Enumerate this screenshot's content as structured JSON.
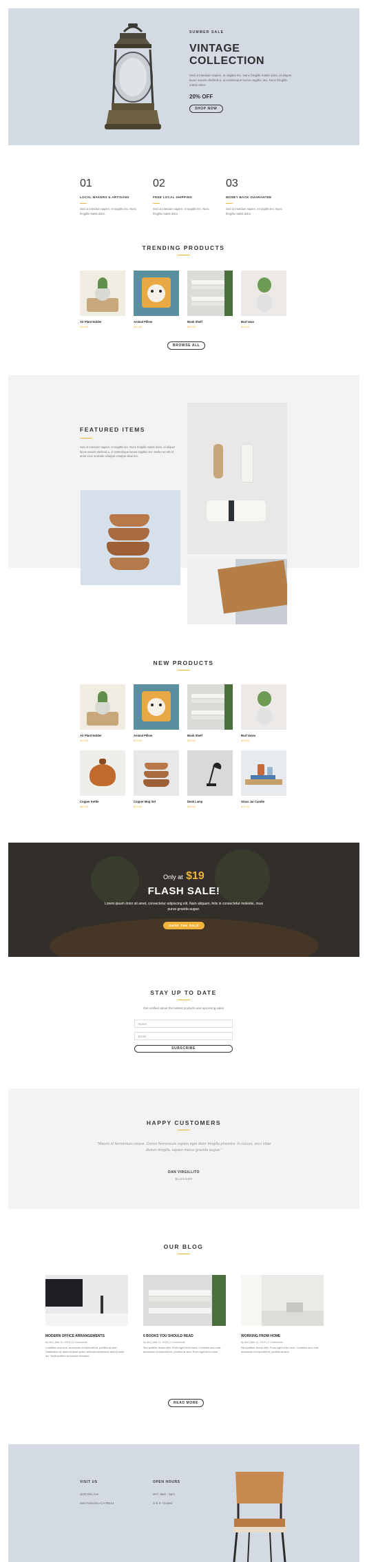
{
  "hero": {
    "eyebrow": "SUMMER SALE",
    "title_line1": "VINTAGE",
    "title_line2": "COLLECTION",
    "description": "Sed ut interdum sapien, et sagittis leo. Nunc fringilla mattis dolor, id aliquet lacus mauris eleifend a, ut scelerisque luctus sagittis, leo. Nunc fringilla mattis dolor.",
    "discount": "20% OFF",
    "cta": "SHOP NOW"
  },
  "features": [
    {
      "num": "01",
      "title": "LOCAL MAKERS & ARTISANS",
      "desc": "Sed ut interdum sapien, et sagittis leo. Nunc fringilla mattis dolor."
    },
    {
      "num": "02",
      "title": "FREE LOCAL SHIPPING",
      "desc": "Sed ut interdum sapien, et sagittis leo. Nunc fringilla mattis dolor."
    },
    {
      "num": "03",
      "title": "MONEY BACK GUARANTEE",
      "desc": "Sed ut interdum sapien, et sagittis leo. Nunc fringilla mattis dolor."
    }
  ],
  "trending": {
    "title": "TRENDING PRODUCTS",
    "products": [
      {
        "name": "Air Plant Holder",
        "price": "$10.00"
      },
      {
        "name": "Animal Pillow",
        "price": "$15.00"
      },
      {
        "name": "Book Shelf",
        "price": "$30.00"
      },
      {
        "name": "Bud Vase",
        "price": "$20.00"
      }
    ],
    "cta": "BROWSE ALL"
  },
  "featured": {
    "title": "FEATURED ITEMS",
    "description": "Sed ut interdum sapien, et sagittis leo. Nunc fringilla mattis dolor, id aliquet lacus mauris eleifend a, ut scelerisque luctus sagittis, leo. Nulla nec elit et amet eros molestie volutpat volutpat vitae leo."
  },
  "new_products": {
    "title": "NEW PRODUCTS",
    "products": [
      {
        "name": "Air Plant Holder",
        "price": "$10.00"
      },
      {
        "name": "Animal Pillow",
        "price": "$15.00"
      },
      {
        "name": "Book Shelf",
        "price": "$30.00"
      },
      {
        "name": "Bud Vases",
        "price": "$20.00"
      },
      {
        "name": "Copper Kettle",
        "price": "$45.00"
      },
      {
        "name": "Copper Mug Set",
        "price": "$25.00"
      },
      {
        "name": "Desk Lamp",
        "price": "$40.00"
      },
      {
        "name": "Glass Jar Candle",
        "price": "$12.00"
      }
    ]
  },
  "flash": {
    "prefix": "Only at",
    "price": "$19",
    "title": "FLASH SALE!",
    "description": "Lorem ipsum dolor sit amet, consectetur adipiscing elit. Nam aliquam, felis in consectetur molestie, risus purus gravida augue.",
    "cta": "SHOP THE SALE"
  },
  "newsletter": {
    "title": "STAY UP TO DATE",
    "subtitle": "Get notified about the lastest products and upcoming sales",
    "name_placeholder": "Name",
    "email_placeholder": "Email",
    "cta": "SUBSCRIBE"
  },
  "testimonial": {
    "title": "HAPPY CUSTOMERS",
    "quote": "\"Mauris id fermentum neque. Donec fermentum sapien eget dolor fringilla pharetra. In cursus, arcu vitae dictum fringilla, sapien metus gravida augue.\"",
    "author": "DAN VIRGILLITO",
    "role": "BLOGGER"
  },
  "blog": {
    "title": "OUR BLOG",
    "posts": [
      {
        "title": "MODERN OFFICE ARRANGEMENTS",
        "meta": "by divi | Mar 11, 2019 | 0 Comments",
        "desc": "Curabitur arcu erat, accumsan id imperdiet et, porttitor at sem. Vestibulum ac diam sit amet quam vehicula elementum sed sit amet dui. Nulla porttitor accumsan tincidunt."
      },
      {
        "title": "6 BOOKS YOU SHOULD READ",
        "meta": "by divi | Mar 11, 2019 | 0 Comments",
        "desc": "Sed porttitor lectus nibh. Proin eget tortor risus. Curabitur arcu erat, accumsan id imperdiet et, porttitor at sem. Proin eget tortor risus."
      },
      {
        "title": "WORKING FROM HOME",
        "meta": "by divi | Mar 11, 2019 | 0 Comments",
        "desc": "Sed porttitor lectus nibh. Proin eget tortor risus. Curabitur arcu erat, accumsan id imperdiet et, porttitor at sem."
      }
    ],
    "cta": "READ MORE"
  },
  "footer": {
    "visit_title": "VISIT US",
    "visit_line1": "1120 Divi Ave",
    "visit_line2": "San Francisco CA 95113",
    "hours_title": "OPEN HOURS",
    "hours_line1": "M-F: 9am - 6pm",
    "hours_line2": "S & S: Closed"
  },
  "colors": {
    "accent": "#f2b33d",
    "hero_bg": "#d4dae3",
    "section_bg": "#f3f3f3"
  }
}
